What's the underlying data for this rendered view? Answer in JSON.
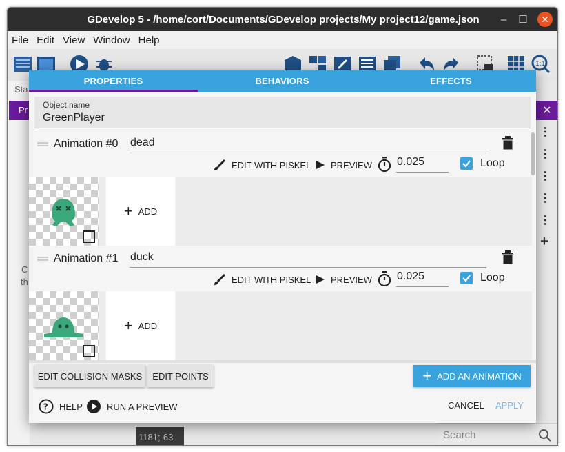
{
  "window": {
    "title": "GDevelop 5 - /home/cort/Documents/GDevelop projects/My project12/game.json",
    "controls": {
      "minimize": "–",
      "maximize": "☐",
      "close": "✕"
    }
  },
  "menubar": {
    "items": [
      "File",
      "Edit",
      "View",
      "Window",
      "Help"
    ]
  },
  "background": {
    "left_tab_text": "Sta",
    "purple_text": "Pr",
    "close_glyph": "✕",
    "side_text_1": "C",
    "side_text_2": "th",
    "coordinates": "1181;-63",
    "search_placeholder": "Search",
    "row_menu_glyph": "⋮",
    "row_add_glyph": "+"
  },
  "dialog": {
    "tabs": [
      {
        "label": "PROPERTIES",
        "active": true
      },
      {
        "label": "BEHAVIORS",
        "active": false
      },
      {
        "label": "EFFECTS",
        "active": false
      }
    ],
    "object_name": {
      "label": "Object name",
      "value": "GreenPlayer"
    },
    "animations": [
      {
        "title": "Animation #0",
        "name": "dead",
        "edit_label": "EDIT WITH PISKEL",
        "preview_label": "PREVIEW",
        "time_between_frames": "0.025",
        "loop_label": "Loop",
        "loop_checked": true,
        "add_label": "ADD",
        "frame_icon": "green-slime-dead"
      },
      {
        "title": "Animation #1",
        "name": "duck",
        "edit_label": "EDIT WITH PISKEL",
        "preview_label": "PREVIEW",
        "time_between_frames": "0.025",
        "loop_label": "Loop",
        "loop_checked": true,
        "add_label": "ADD",
        "frame_icon": "green-slime-duck"
      }
    ],
    "buttons": {
      "edit_collision_masks": "EDIT COLLISION MASKS",
      "edit_points": "EDIT POINTS",
      "add_animation": "ADD AN ANIMATION",
      "help": "HELP",
      "run_preview": "RUN A PREVIEW",
      "cancel": "CANCEL",
      "apply": "APPLY"
    },
    "colors": {
      "accent": "#38a3dc",
      "tab_indicator": "#6a1b9a",
      "slime": "#3aa87a"
    }
  }
}
